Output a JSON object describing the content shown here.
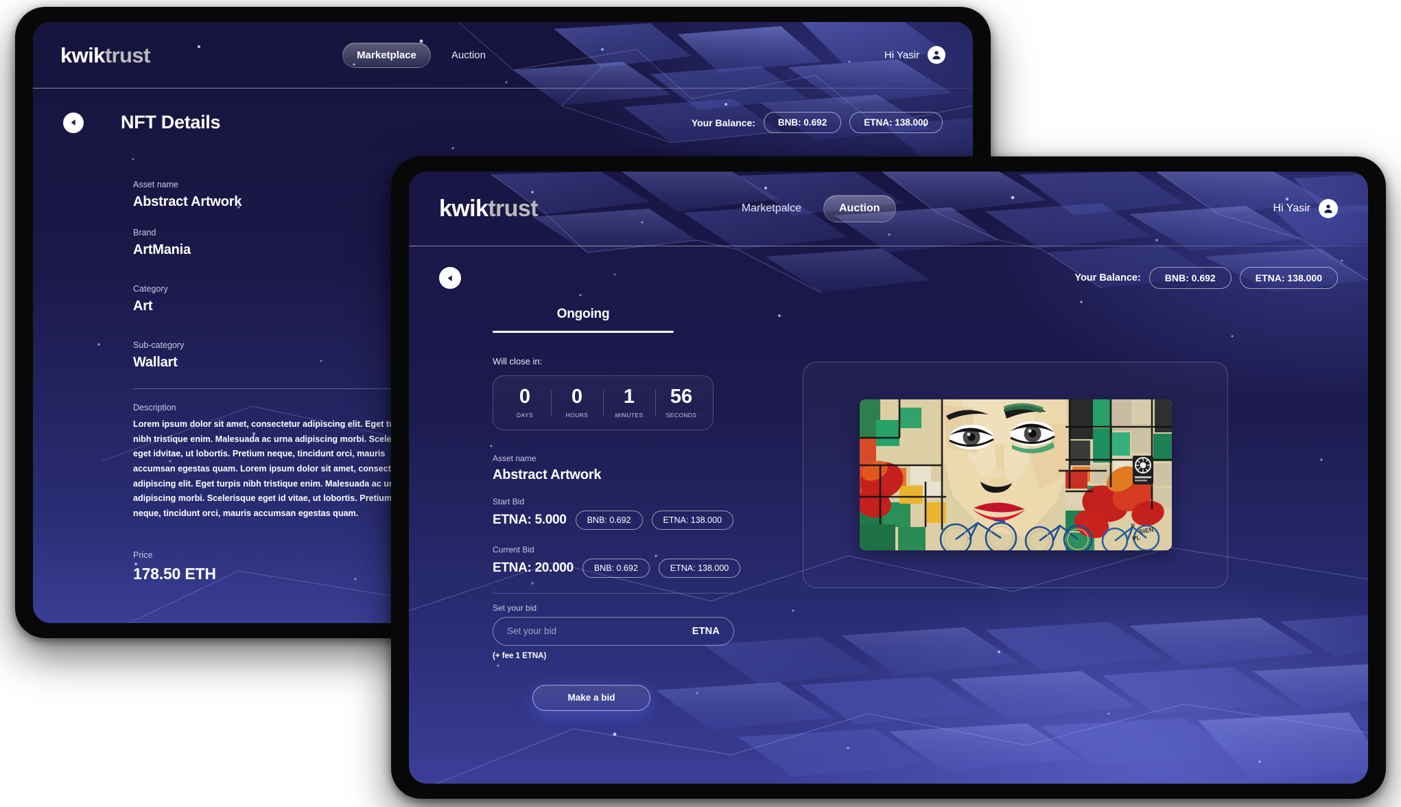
{
  "brand": {
    "part1": "kwik",
    "part2": "trust"
  },
  "back_tablet": {
    "nav": [
      {
        "label": "Marketplace",
        "active": true
      },
      {
        "label": "Auction",
        "active": false
      }
    ],
    "profile": {
      "greeting": "Hi Yasir",
      "avatar_icon": "user-circle-icon"
    },
    "back_icon": "back-arrow-icon",
    "page_title": "NFT Details",
    "balance": {
      "label": "Your Balance:",
      "pills": [
        "BNB: 0.692",
        "ETNA: 138.000"
      ]
    },
    "fields": [
      {
        "label": "Asset name",
        "value": "Abstract Artwork"
      },
      {
        "label": "Brand",
        "value": "ArtMania"
      },
      {
        "label": "Category",
        "value": "Art"
      },
      {
        "label": "Sub-category",
        "value": "Wallart"
      }
    ],
    "description": {
      "label": "Description",
      "text": "Lorem ipsum dolor sit amet, consectetur adipiscing elit. Eget turpis nibh tristique enim. Malesuada ac urna adipiscing morbi. Scelerisque eget idvitae, ut lobortis. Pretium neque, tincidunt orci, mauris accumsan egestas quam. Lorem ipsum dolor sit amet, consectetur adipiscing elit. Eget turpis nibh tristique enim. Malesuada ac urna adipiscing morbi. Scelerisque eget id vitae, ut lobortis. Pretium neque, tincidunt orci, mauris accumsan egestas quam."
    },
    "price": {
      "label": "Price",
      "value": "178.50 ETH"
    }
  },
  "front_tablet": {
    "nav": [
      {
        "label": "Marketpalce",
        "active": false
      },
      {
        "label": "Auction",
        "active": true
      }
    ],
    "profile": {
      "greeting": "Hi Yasir",
      "avatar_icon": "user-circle-icon"
    },
    "back_icon": "back-arrow-icon",
    "balance": {
      "label": "Your Balance:",
      "pills": [
        "BNB: 0.692",
        "ETNA: 138.000"
      ]
    },
    "tab": {
      "label": "Ongoing"
    },
    "countdown": {
      "caption": "Will close in:",
      "cells": [
        {
          "value": "0",
          "unit": "DAYS"
        },
        {
          "value": "0",
          "unit": "HOURS"
        },
        {
          "value": "1",
          "unit": "MINUTES"
        },
        {
          "value": "56",
          "unit": "SECONDS"
        }
      ]
    },
    "asset": {
      "label": "Asset name",
      "value": "Abstract Artwork"
    },
    "start_bid": {
      "label": "Start Bid",
      "amount": "ETNA: 5.000",
      "pills": [
        "BNB: 0.692",
        "ETNA: 138.000"
      ]
    },
    "current_bid": {
      "label": "Current Bid",
      "amount": "ETNA: 20.000",
      "pills": [
        "BNB: 0.692",
        "ETNA: 138.000"
      ]
    },
    "set_bid": {
      "label": "Set your bid",
      "placeholder": "Set your bid",
      "value": "",
      "currency": "ETNA",
      "fee_note": "(+ fee 1 ETNA)"
    },
    "make_bid_label": "Make a bid",
    "artwork": {
      "alt_name": "abstract-mural-artwork"
    }
  },
  "colors": {
    "screen_top": "#191645",
    "screen_bottom": "#3b3f97",
    "accent_white": "#ffffff",
    "muted_text": "#c7c9e4",
    "bezel": "#080808"
  }
}
